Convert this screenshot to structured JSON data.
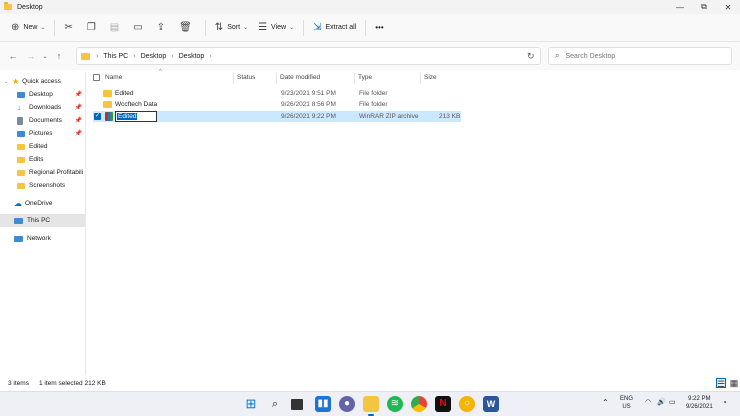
{
  "window": {
    "title": "Desktop",
    "minimize_glyph": "—",
    "maximize_glyph": "⧉",
    "close_glyph": "✕"
  },
  "toolbar": {
    "new_label": "New",
    "sort_label": "Sort",
    "view_label": "View",
    "extract_label": "Extract all",
    "more_glyph": "•••"
  },
  "address": {
    "crumbs": [
      "This PC",
      "Desktop",
      "Desktop"
    ],
    "search_placeholder": "Search Desktop"
  },
  "sidebar": {
    "items": [
      {
        "label": "Quick access",
        "icon": "star-icon",
        "color": "#f0a800"
      },
      {
        "label": "Desktop",
        "icon": "desktop-icon",
        "color": "#3c8bd9",
        "pinned": true
      },
      {
        "label": "Downloads",
        "icon": "download-icon",
        "color": "#2a9d5c",
        "pinned": true
      },
      {
        "label": "Documents",
        "icon": "documents-icon",
        "color": "#7a8aa0",
        "pinned": true
      },
      {
        "label": "Pictures",
        "icon": "pictures-icon",
        "color": "#3c8bd9",
        "pinned": true
      },
      {
        "label": "Edited",
        "icon": "folder-icon",
        "color": "#f5c542"
      },
      {
        "label": "Edits",
        "icon": "folder-icon",
        "color": "#f5c542"
      },
      {
        "label": "Regional Profitabili",
        "icon": "folder-icon",
        "color": "#f5c542"
      },
      {
        "label": "Screenshots",
        "icon": "folder-icon",
        "color": "#f5c542"
      },
      {
        "label": "OneDrive",
        "icon": "cloud-icon",
        "color": "#0f6cbd"
      },
      {
        "label": "This PC",
        "icon": "pc-icon",
        "color": "#3c8bd9"
      },
      {
        "label": "Network",
        "icon": "network-icon",
        "color": "#3c8bd9"
      }
    ]
  },
  "columns": {
    "name": "Name",
    "status": "Status",
    "date": "Date modified",
    "type": "Type",
    "size": "Size"
  },
  "files": [
    {
      "name": "Edited",
      "date": "9/23/2021 9:51 PM",
      "type": "File folder",
      "size": ""
    },
    {
      "name": "Wccftech Data",
      "date": "9/26/2021 8:56 PM",
      "type": "File folder",
      "size": ""
    },
    {
      "name": "Edited",
      "date": "9/26/2021 9:22 PM",
      "type": "WinRAR ZIP archive",
      "size": "213 KB"
    }
  ],
  "status": {
    "count": "3 items",
    "selection": "1 item selected  212 KB"
  },
  "tray": {
    "lang_top": "ENG",
    "lang_bottom": "US",
    "time": "9:22 PM",
    "date": "9/26/2021"
  },
  "colors": {
    "accent": "#0067c0",
    "selection": "#cce8ff",
    "folder": "#f5c542"
  }
}
